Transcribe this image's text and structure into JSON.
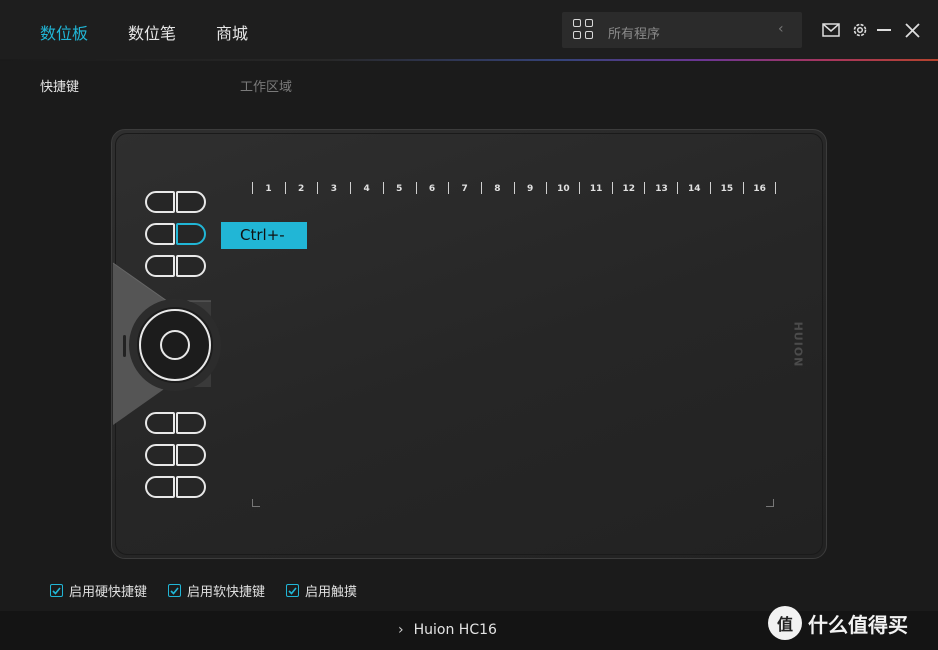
{
  "nav": {
    "tabs": [
      "数位板",
      "数位笔",
      "商城"
    ],
    "active": 0
  },
  "search": {
    "placeholder": "所有程序"
  },
  "subtabs": {
    "shortcuts": "快捷键",
    "work_area": "工作区域"
  },
  "ruler": [
    "1",
    "2",
    "3",
    "4",
    "5",
    "6",
    "7",
    "8",
    "9",
    "10",
    "11",
    "12",
    "13",
    "14",
    "15",
    "16"
  ],
  "callout": {
    "text": "Ctrl+-"
  },
  "tablet": {
    "brand": "HUION"
  },
  "checks": [
    {
      "label": "启用硬快捷键",
      "checked": true
    },
    {
      "label": "启用软快捷键",
      "checked": true
    },
    {
      "label": "启用触摸",
      "checked": true
    }
  ],
  "footer": {
    "device": "Huion HC16"
  },
  "watermark": {
    "logo": "值",
    "text": "什么值得买"
  },
  "colors": {
    "accent": "#21b6d6",
    "background": "#1b1b1b"
  }
}
